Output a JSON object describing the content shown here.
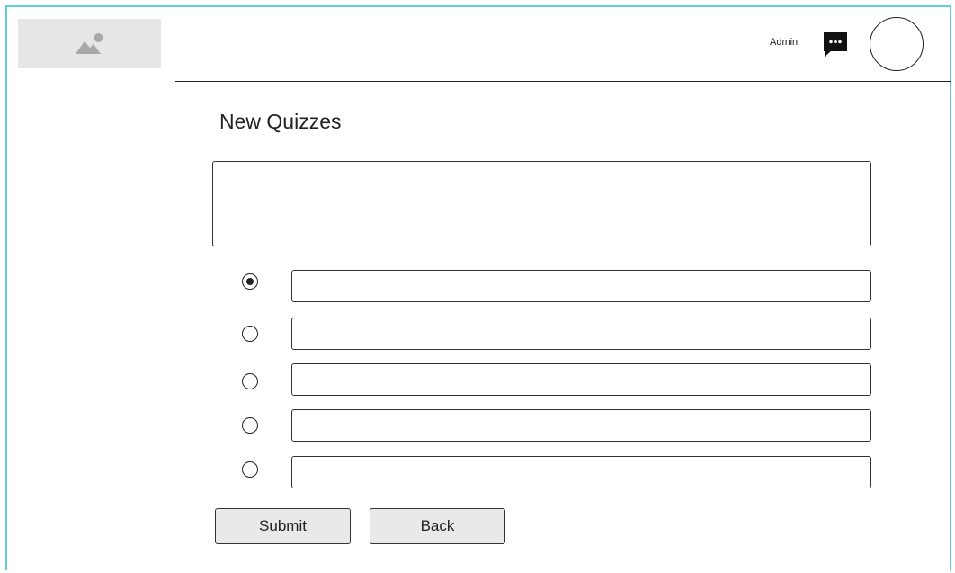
{
  "header": {
    "user_label": "Admin",
    "icons": {
      "messages": "chat-bubble-icon",
      "avatar": "avatar-circle"
    }
  },
  "sidebar": {
    "logo_icon": "image-placeholder-icon"
  },
  "main": {
    "title": "New Quizzes",
    "question": {
      "value": "",
      "placeholder": ""
    },
    "answers": [
      {
        "value": "",
        "selected": true
      },
      {
        "value": "",
        "selected": false
      },
      {
        "value": "",
        "selected": false
      },
      {
        "value": "",
        "selected": false
      },
      {
        "value": "",
        "selected": false
      }
    ],
    "buttons": {
      "submit_label": "Submit",
      "back_label": "Back"
    }
  },
  "colors": {
    "frame_accent": "#5ecfd6",
    "logo_bg": "#e6e6e6",
    "logo_icon": "#a8a8a8",
    "button_bg": "#e9e9e9"
  }
}
